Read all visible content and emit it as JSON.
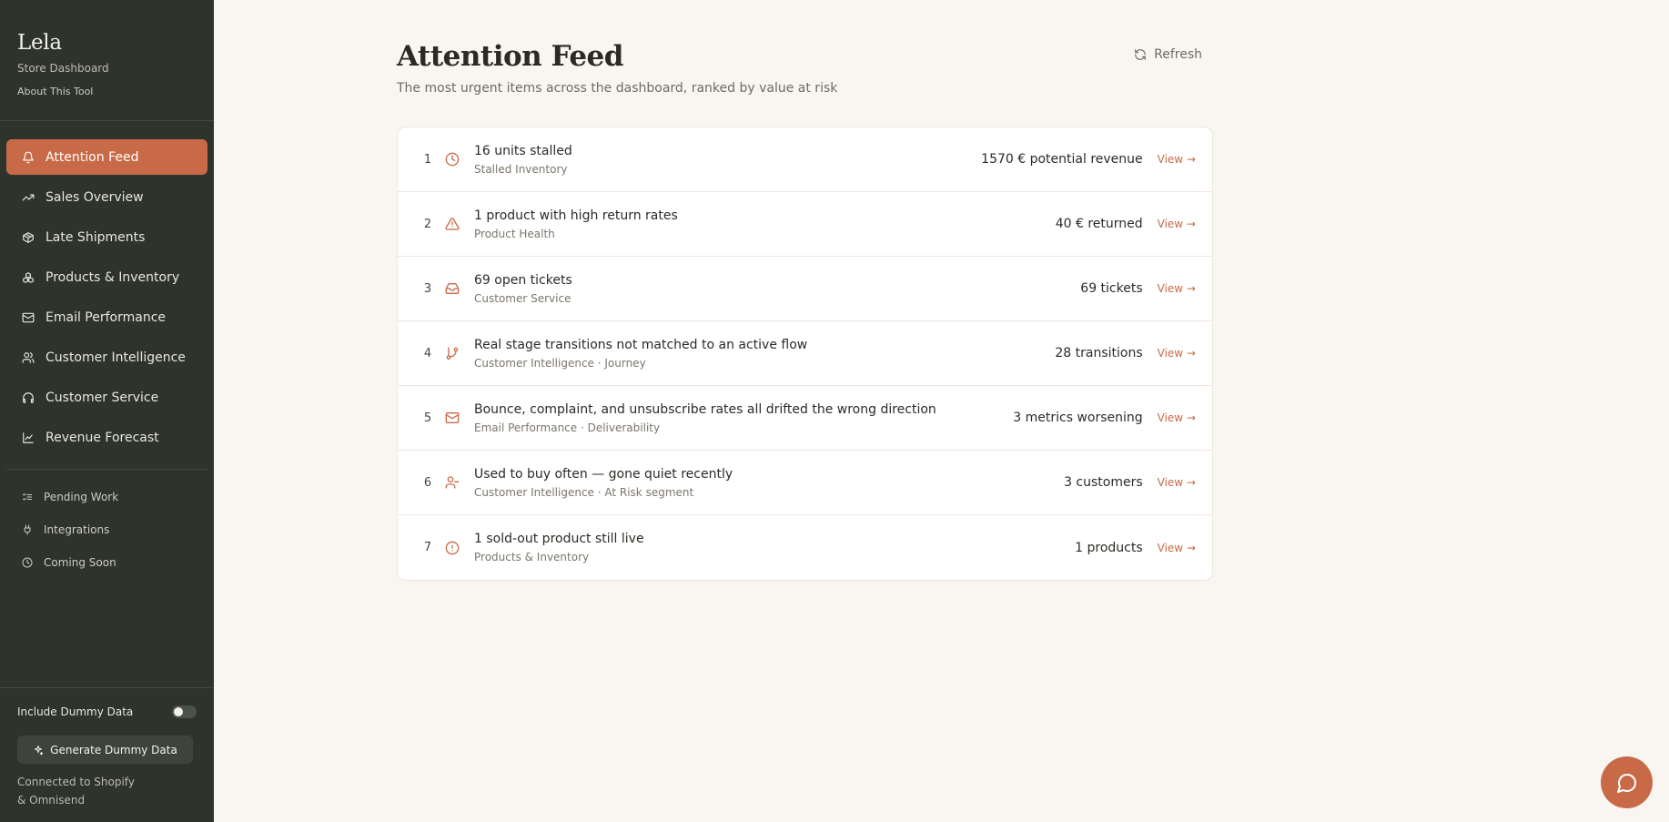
{
  "brand": {
    "name": "Lela",
    "subtitle": "Store Dashboard",
    "about": "About This Tool"
  },
  "nav": {
    "items": [
      {
        "label": "Attention Feed",
        "icon": "bell-icon",
        "active": true
      },
      {
        "label": "Sales Overview",
        "icon": "trending-up-icon"
      },
      {
        "label": "Late Shipments",
        "icon": "package-icon"
      },
      {
        "label": "Products & Inventory",
        "icon": "boxes-icon"
      },
      {
        "label": "Email Performance",
        "icon": "mail-icon"
      },
      {
        "label": "Customer Intelligence",
        "icon": "users-icon"
      },
      {
        "label": "Customer Service",
        "icon": "headphones-icon"
      },
      {
        "label": "Revenue Forecast",
        "icon": "line-chart-icon"
      }
    ]
  },
  "secondary_nav": {
    "items": [
      {
        "label": "Pending Work",
        "icon": "list-checks-icon"
      },
      {
        "label": "Integrations",
        "icon": "plug-icon"
      },
      {
        "label": "Coming Soon",
        "icon": "clock-icon"
      }
    ]
  },
  "footer": {
    "toggle_label": "Include Dummy Data",
    "toggle_on": false,
    "generate_label": "Generate Dummy Data",
    "connected_line1": "Connected to Shopify",
    "connected_line2": "& Omnisend"
  },
  "page": {
    "title": "Attention Feed",
    "subtitle": "The most urgent items across the dashboard, ranked by value at risk",
    "refresh_label": "Refresh"
  },
  "feed": [
    {
      "rank": "1",
      "icon": "clock-icon",
      "title": "16 units stalled",
      "sub": "Stalled Inventory",
      "metric": "1570 € potential revenue",
      "action": "View →"
    },
    {
      "rank": "2",
      "icon": "warning-triangle-icon",
      "title": "1 product with high return rates",
      "sub": "Product Health",
      "metric": "40 € returned",
      "action": "View →"
    },
    {
      "rank": "3",
      "icon": "inbox-icon",
      "title": "69 open tickets",
      "sub": "Customer Service",
      "metric": "69 tickets",
      "action": "View →"
    },
    {
      "rank": "4",
      "icon": "git-branch-icon",
      "title": "Real stage transitions not matched to an active flow",
      "sub": "Customer Intelligence · Journey",
      "metric": "28 transitions",
      "action": "View →"
    },
    {
      "rank": "5",
      "icon": "mail-icon",
      "title": "Bounce, complaint, and unsubscribe rates all drifted the wrong direction",
      "sub": "Email Performance · Deliverability",
      "metric": "3 metrics worsening",
      "action": "View →"
    },
    {
      "rank": "6",
      "icon": "user-minus-icon",
      "title": "Used to buy often — gone quiet recently",
      "sub": "Customer Intelligence · At Risk segment",
      "metric": "3 customers",
      "action": "View →"
    },
    {
      "rank": "7",
      "icon": "alert-circle-icon",
      "title": "1 sold-out product still live",
      "sub": "Products & Inventory",
      "metric": "1 products",
      "action": "View →"
    }
  ],
  "colors": {
    "sidebar_bg": "#2e332b",
    "accent": "#c86a48",
    "page_bg": "#f9f6f2"
  }
}
